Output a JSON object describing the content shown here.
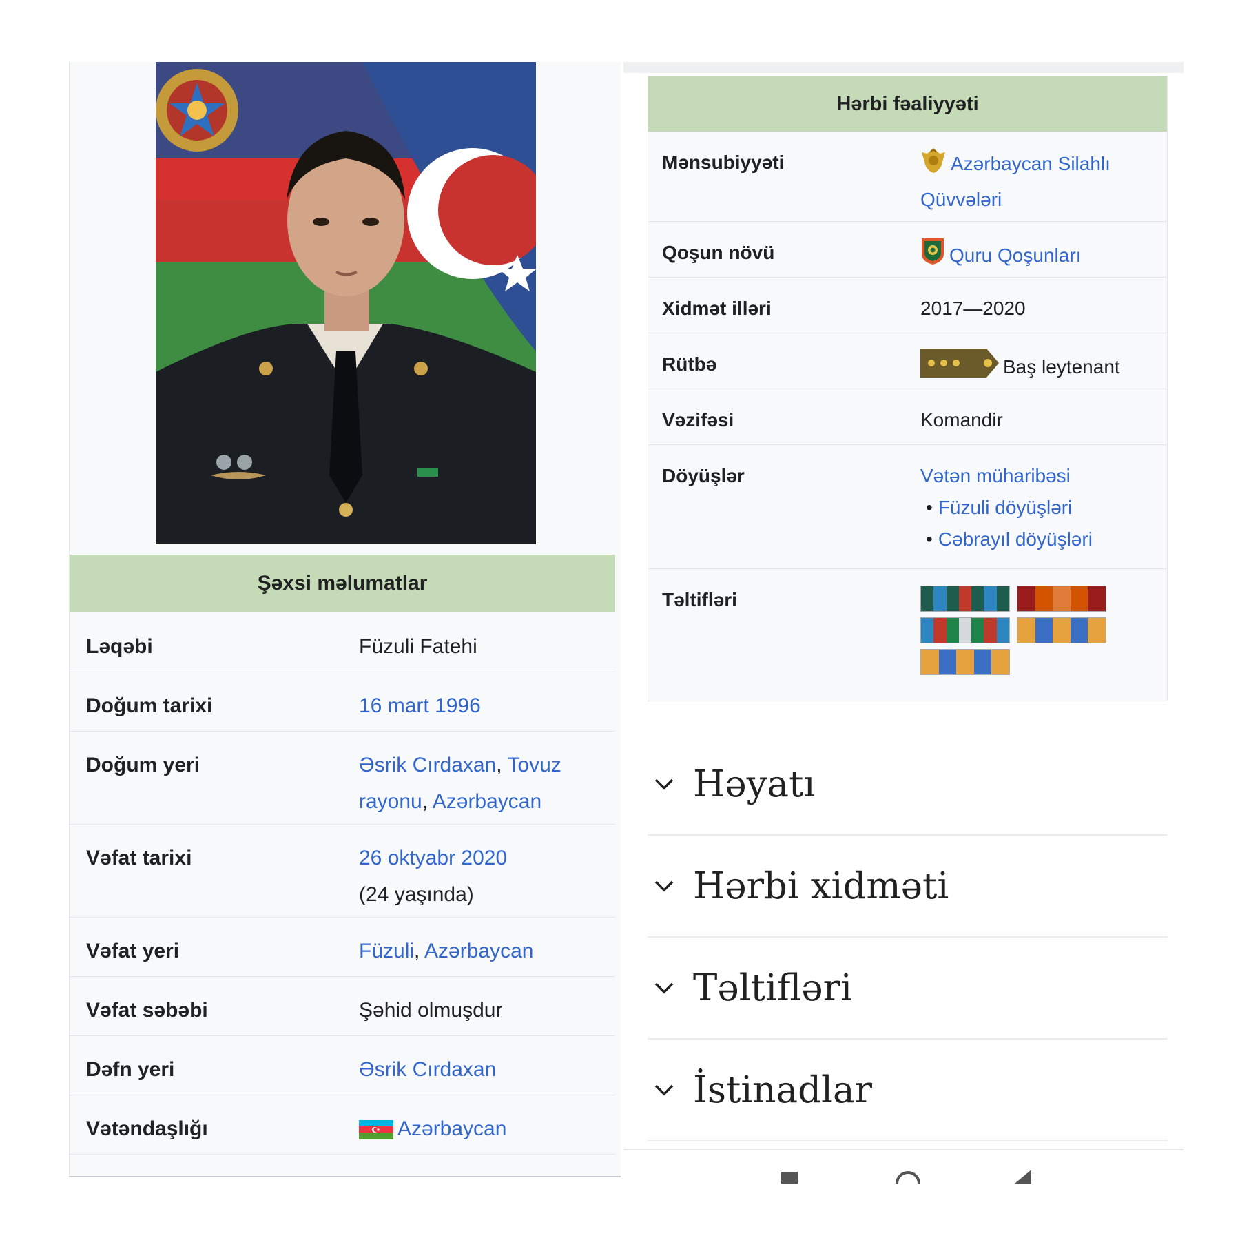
{
  "left_infobox": {
    "section_title": "Şəxsi məlumatlar",
    "rows": [
      {
        "label": "Ləqəbi",
        "value": "Füzuli Fatehi"
      },
      {
        "label": "Doğum tarixi",
        "link": "16 mart 1996"
      },
      {
        "label": "Doğum yeri",
        "link1": "Əsrik Cırdaxan",
        "sep1": ", ",
        "link2": "Tovuz rayonu",
        "sep2": ", ",
        "link3": "Azərbaycan"
      },
      {
        "label": "Vəfat tarixi",
        "link": "26 oktyabr 2020",
        "note": "(24 yaşında)"
      },
      {
        "label": "Vəfat yeri",
        "link1": "Füzuli",
        "sep1": ", ",
        "link2": "Azərbaycan"
      },
      {
        "label": "Vəfat səbəbi",
        "value": "Şəhid olmuşdur"
      },
      {
        "label": "Dəfn yeri",
        "link": "Əsrik Cırdaxan"
      },
      {
        "label": "Vətəndaşlığı",
        "link": "Azərbaycan",
        "icon": "azerbaijan-flag-icon"
      }
    ]
  },
  "right_infobox": {
    "section_title": "Hərbi fəaliyyəti",
    "rows": [
      {
        "label": "Mənsubiyyəti",
        "link": "Azərbaycan Silahlı Qüvvələri",
        "icon": "armed-forces-emblem-icon"
      },
      {
        "label": "Qoşun növü",
        "link": "Quru Qoşunları",
        "icon": "land-forces-emblem-icon"
      },
      {
        "label": "Xidmət illəri",
        "value": "2017—2020"
      },
      {
        "label": "Rütbə",
        "value": "Baş leytenant",
        "icon": "rank-insignia-icon"
      },
      {
        "label": "Vəzifəsi",
        "value": "Komandir"
      },
      {
        "label": "Döyüşlər",
        "link": "Vətən müharibəsi",
        "sub_links": [
          "Füzuli döyüşləri",
          "Cəbrayıl döyüşləri"
        ]
      },
      {
        "label": "Təltifləri"
      }
    ],
    "ribbons": [
      {
        "colors": [
          "#1e5c4e",
          "#2e86c1",
          "#1e5c4e",
          "#c0392b",
          "#1e5c4e",
          "#2e86c1",
          "#1e5c4e"
        ]
      },
      {
        "colors": [
          "#9b1c1c",
          "#d35400",
          "#e07b39",
          "#d35400",
          "#9b1c1c"
        ]
      },
      {
        "colors": [
          "#2e86c1",
          "#c0392b",
          "#1e8449",
          "#d5d8dc",
          "#1e8449",
          "#c0392b",
          "#2e86c1"
        ]
      },
      {
        "colors": [
          "#e6a23c",
          "#3a6fc4",
          "#e6a23c",
          "#3a6fc4",
          "#e6a23c"
        ]
      },
      {
        "colors": [
          "#e6a23c",
          "#3a6fc4",
          "#e6a23c",
          "#3a6fc4",
          "#e6a23c"
        ]
      }
    ]
  },
  "sections": [
    {
      "title": "Həyatı",
      "icon": "chevron-down-icon"
    },
    {
      "title": "Hərbi xidməti",
      "icon": "chevron-down-icon"
    },
    {
      "title": "Təltifləri",
      "icon": "chevron-down-icon"
    },
    {
      "title": "İstinadlar",
      "icon": "chevron-down-icon"
    }
  ],
  "colors": {
    "section_header_bg": "#c5dbb7",
    "link": "#3366cc",
    "infobox_bg": "#f8f9fa"
  }
}
